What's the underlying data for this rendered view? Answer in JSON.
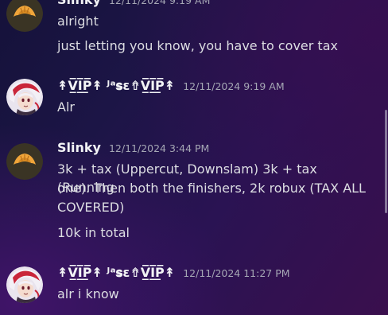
{
  "messages": [
    {
      "author": "Slinky",
      "timestamp": "12/11/2024 9:19 AM",
      "lines": [
        "alright",
        "just letting you know, you have to cover tax"
      ]
    },
    {
      "author": "↟V̲̅I̲̅P̲̅↟ ᴶᵃ𝐬ɛ⇮V̲̅I̲̅P̲̅↟",
      "timestamp": "12/11/2024 9:19 AM",
      "lines": [
        "Alr"
      ]
    },
    {
      "author": "Slinky",
      "timestamp": "12/11/2024 3:44 PM",
      "lines": [
        "3k + tax (Uppercut, Downslam) 3k + tax (Running",
        "one). Then both the finishers, 2k robux (TAX ALL",
        "COVERED)",
        "10k in total"
      ]
    },
    {
      "author": "↟V̲̅I̲̅P̲̅↟ ᴶᵃ𝐬ɛ⇮V̲̅I̲̅P̲̅↟",
      "timestamp": "12/11/2024 11:27 PM",
      "lines": [
        "alr i know"
      ]
    }
  ],
  "icons": {
    "slinky_avatar": "croissant-avatar-icon",
    "vip_avatar": "anime-character-avatar-icon"
  },
  "colors": {
    "author_name": "#f2f3f5",
    "message_text": "#dcdde2",
    "timestamp": "#a5a7b4",
    "croissant_avatar_bg": "#3a3424",
    "croissant_fill": "#f0a53a"
  }
}
